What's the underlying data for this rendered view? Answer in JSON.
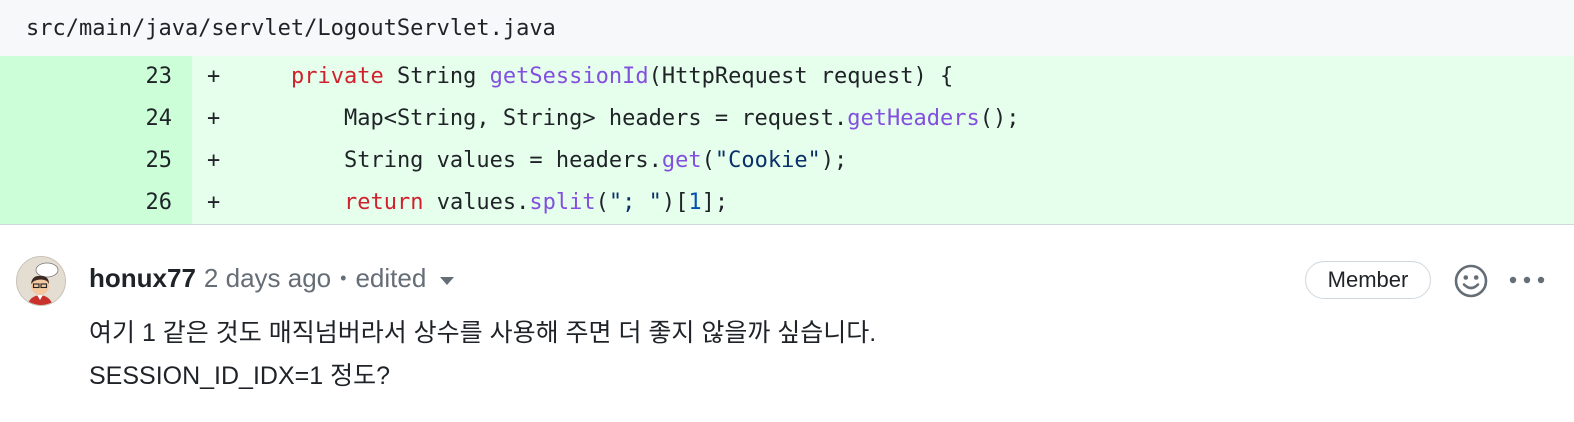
{
  "file": {
    "path": "src/main/java/servlet/LogoutServlet.java"
  },
  "diff": {
    "lines": [
      {
        "number": "23",
        "marker": "+",
        "tokens": [
          {
            "text": "    ",
            "cls": ""
          },
          {
            "text": "private",
            "cls": "kw"
          },
          {
            "text": " String ",
            "cls": ""
          },
          {
            "text": "getSessionId",
            "cls": "fn"
          },
          {
            "text": "(HttpRequest request) {",
            "cls": ""
          }
        ]
      },
      {
        "number": "24",
        "marker": "+",
        "tokens": [
          {
            "text": "        Map<String, String> headers = request.",
            "cls": ""
          },
          {
            "text": "getHeaders",
            "cls": "fn"
          },
          {
            "text": "();",
            "cls": ""
          }
        ]
      },
      {
        "number": "25",
        "marker": "+",
        "tokens": [
          {
            "text": "        String values = headers.",
            "cls": ""
          },
          {
            "text": "get",
            "cls": "fn"
          },
          {
            "text": "(",
            "cls": ""
          },
          {
            "text": "\"Cookie\"",
            "cls": "str"
          },
          {
            "text": ");",
            "cls": ""
          }
        ]
      },
      {
        "number": "26",
        "marker": "+",
        "tokens": [
          {
            "text": "        ",
            "cls": ""
          },
          {
            "text": "return",
            "cls": "kw"
          },
          {
            "text": " values.",
            "cls": ""
          },
          {
            "text": "split",
            "cls": "fn"
          },
          {
            "text": "(",
            "cls": ""
          },
          {
            "text": "\"; \"",
            "cls": "str"
          },
          {
            "text": ")[",
            "cls": ""
          },
          {
            "text": "1",
            "cls": "num"
          },
          {
            "text": "];",
            "cls": ""
          }
        ]
      }
    ]
  },
  "comment": {
    "author": "honux77",
    "time": "2 days ago",
    "separator": "•",
    "edited_label": "edited",
    "badge": "Member",
    "body_lines": [
      "여기 1 같은 것도 매직넘버라서 상수를 사용해 주면 더 좋지 않을까 싶습니다.",
      "SESSION_ID_IDX=1 정도?"
    ]
  },
  "icons": {
    "edited_dropdown": "triangle-down-icon",
    "reaction": "smiley-icon",
    "more": "kebab-horizontal-icon",
    "avatar": "user-avatar"
  },
  "colors": {
    "addition_bg": "#e6ffec",
    "addition_gutter": "#ccffd8",
    "keyword": "#cf222e",
    "function": "#8250df",
    "string": "#0a3069",
    "number": "#0550ae"
  }
}
